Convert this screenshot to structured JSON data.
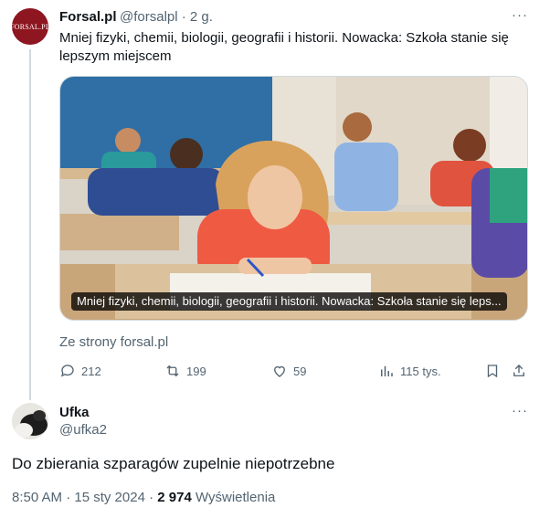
{
  "tweet": {
    "avatar_text": "FORSAL.PL",
    "author_name": "Forsal.pl",
    "handle_time": "@forsalpl · 2 g.",
    "text": "Mniej fizyki, chemii, biologii, geografii i historii. Nowacka: Szkoła stanie się lepszym miejscem",
    "card_caption": "Mniej fizyki, chemii, biologii, geografii i historii. Nowacka: Szkoła stanie się leps...",
    "source": "Ze strony forsal.pl",
    "more_label": "···",
    "stats": {
      "replies": "212",
      "reposts": "199",
      "likes": "59",
      "views": "115 tys."
    }
  },
  "reply": {
    "author_name": "Ufka",
    "handle": "@ufka2",
    "more_label": "···",
    "text": "Do zbierania szparagów zupelnie niepotrzebne",
    "time_date": "8:50 AM · 15 sty 2024 · ",
    "views_count": "2 974",
    "views_label": "Wyświetlenia"
  },
  "colors": {
    "text": "#0f1419",
    "secondary": "#536471",
    "border": "#cfd9de",
    "avatar_bg": "#8d1620"
  }
}
